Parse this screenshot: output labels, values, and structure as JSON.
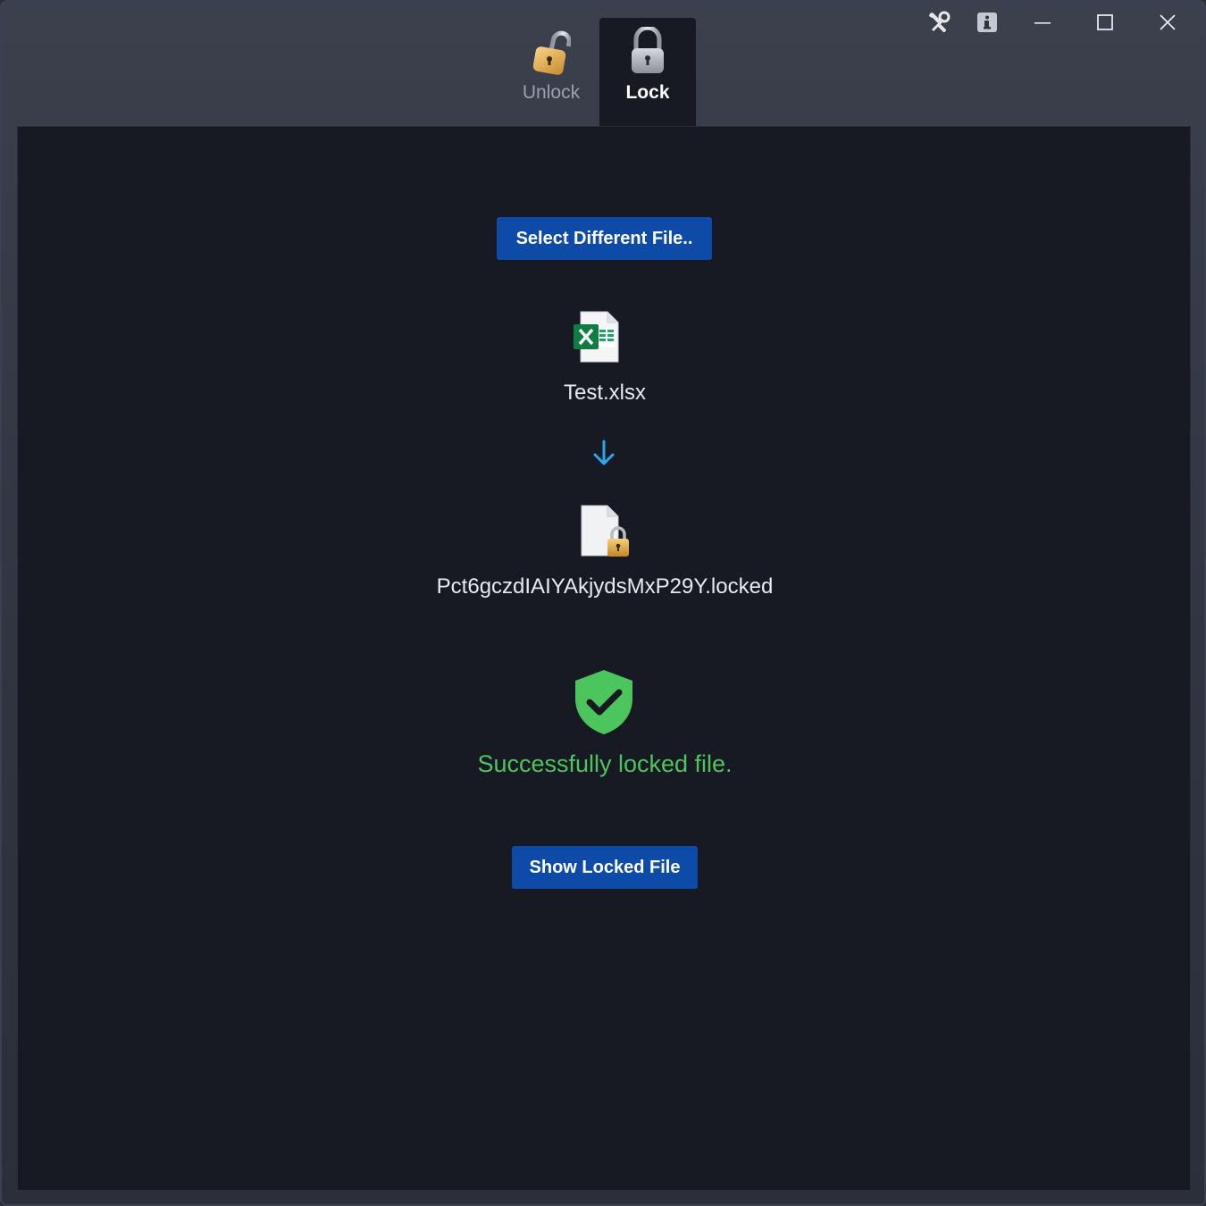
{
  "window": {
    "controls": {
      "tools_icon": "tools-icon",
      "info_icon": "info-icon",
      "minimize_icon": "minimize-icon",
      "maximize_icon": "maximize-icon",
      "close_icon": "close-icon"
    }
  },
  "tabs": [
    {
      "label": "Unlock",
      "icon": "unlocked-padlock-icon",
      "active": false
    },
    {
      "label": "Lock",
      "icon": "locked-padlock-icon",
      "active": true
    }
  ],
  "main": {
    "select_button": "Select Different File..",
    "source_file": {
      "name": "Test.xlsx",
      "icon": "excel-file-icon"
    },
    "arrow_icon": "arrow-down-icon",
    "locked_file": {
      "name": "Pct6gczdIAIYAkjydsMxP29Y.locked",
      "icon": "locked-file-icon"
    },
    "status_icon": "shield-check-icon",
    "status_text": "Successfully locked file.",
    "show_button": "Show Locked File"
  },
  "colors": {
    "accent_button": "#0e4aa8",
    "success": "#4cc55c",
    "arrow": "#2da6f0",
    "panel_bg": "#171923"
  }
}
